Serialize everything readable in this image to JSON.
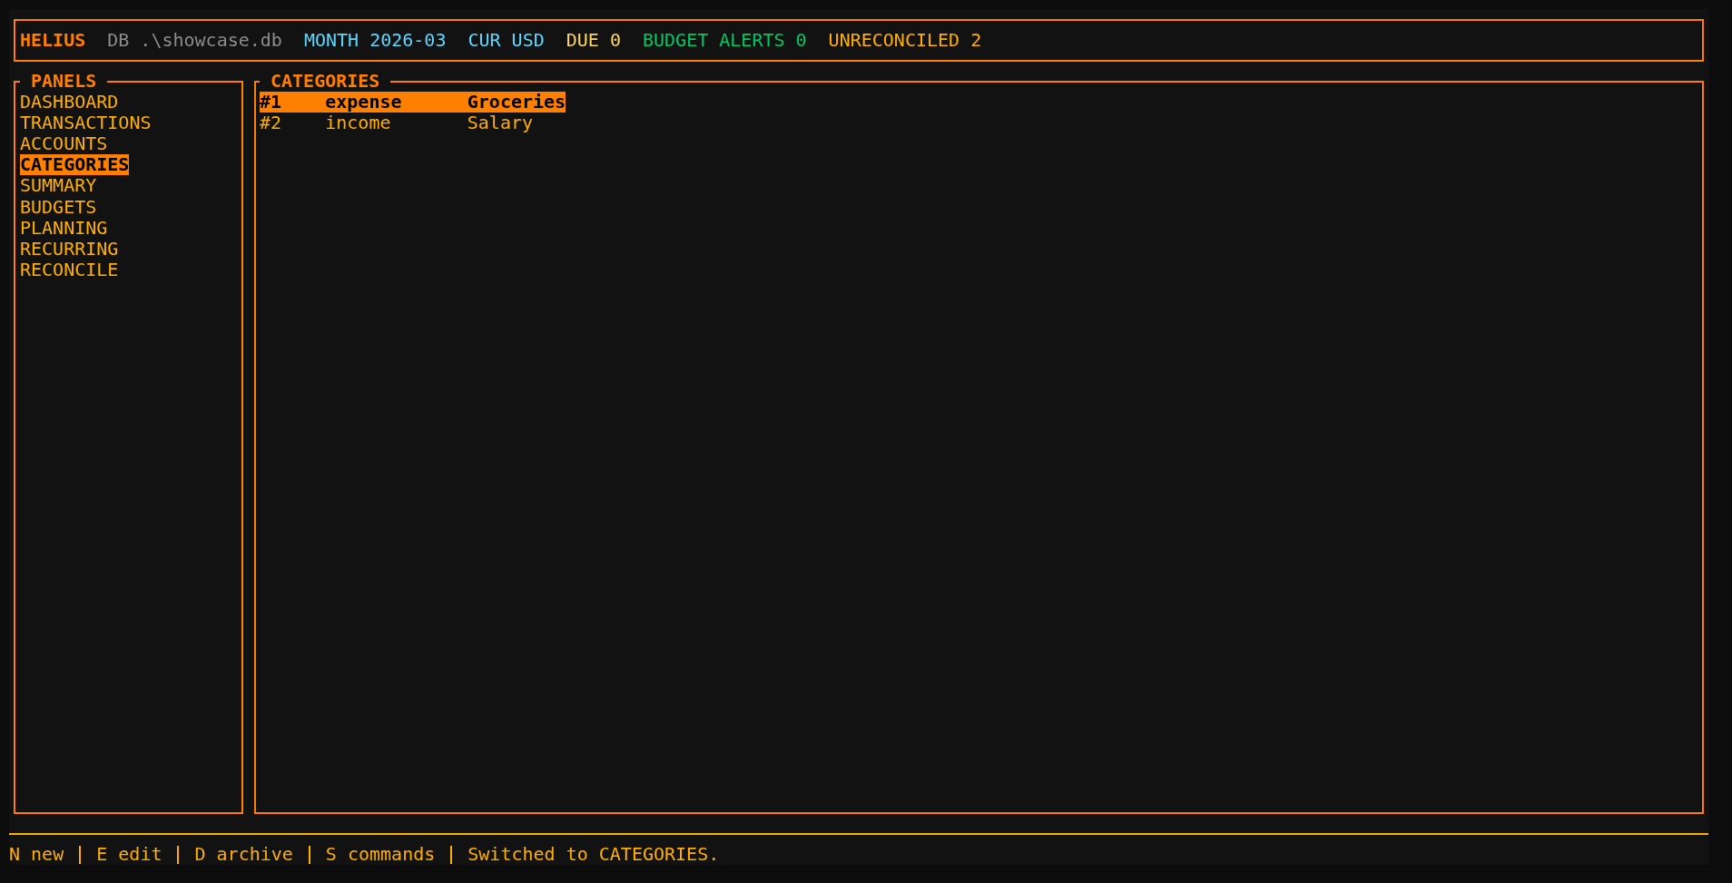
{
  "header": {
    "app_name": "HELIUS",
    "stats": [
      {
        "text": "DB .\\showcase.db",
        "color": "#8c8c8c"
      },
      {
        "text": "MONTH 2026-03",
        "color": "#5fd7ff"
      },
      {
        "text": "CUR USD",
        "color": "#5fd7ff"
      },
      {
        "text": "DUE 0",
        "color": "#ffd75f"
      },
      {
        "text": "BUDGET ALERTS 0",
        "color": "#00c864"
      },
      {
        "text": "UNRECONCILED 2",
        "color": "#ffaf00"
      }
    ]
  },
  "panels": {
    "title": "PANELS",
    "items": [
      {
        "label": "DASHBOARD",
        "selected": false
      },
      {
        "label": "TRANSACTIONS",
        "selected": false
      },
      {
        "label": "ACCOUNTS",
        "selected": false
      },
      {
        "label": "CATEGORIES",
        "selected": true
      },
      {
        "label": "SUMMARY",
        "selected": false
      },
      {
        "label": "BUDGETS",
        "selected": false
      },
      {
        "label": "PLANNING",
        "selected": false
      },
      {
        "label": "RECURRING",
        "selected": false
      },
      {
        "label": "RECONCILE",
        "selected": false
      }
    ]
  },
  "categories": {
    "title": "CATEGORIES",
    "rows": [
      {
        "cells": [
          "#1",
          "expense",
          "Groceries"
        ],
        "selected": true
      },
      {
        "cells": [
          "#2",
          "income",
          "Salary"
        ],
        "selected": false
      }
    ]
  },
  "footer": {
    "hints": [
      "N new",
      "E edit",
      "D archive",
      "S commands"
    ],
    "message": "Switched to CATEGORIES."
  }
}
